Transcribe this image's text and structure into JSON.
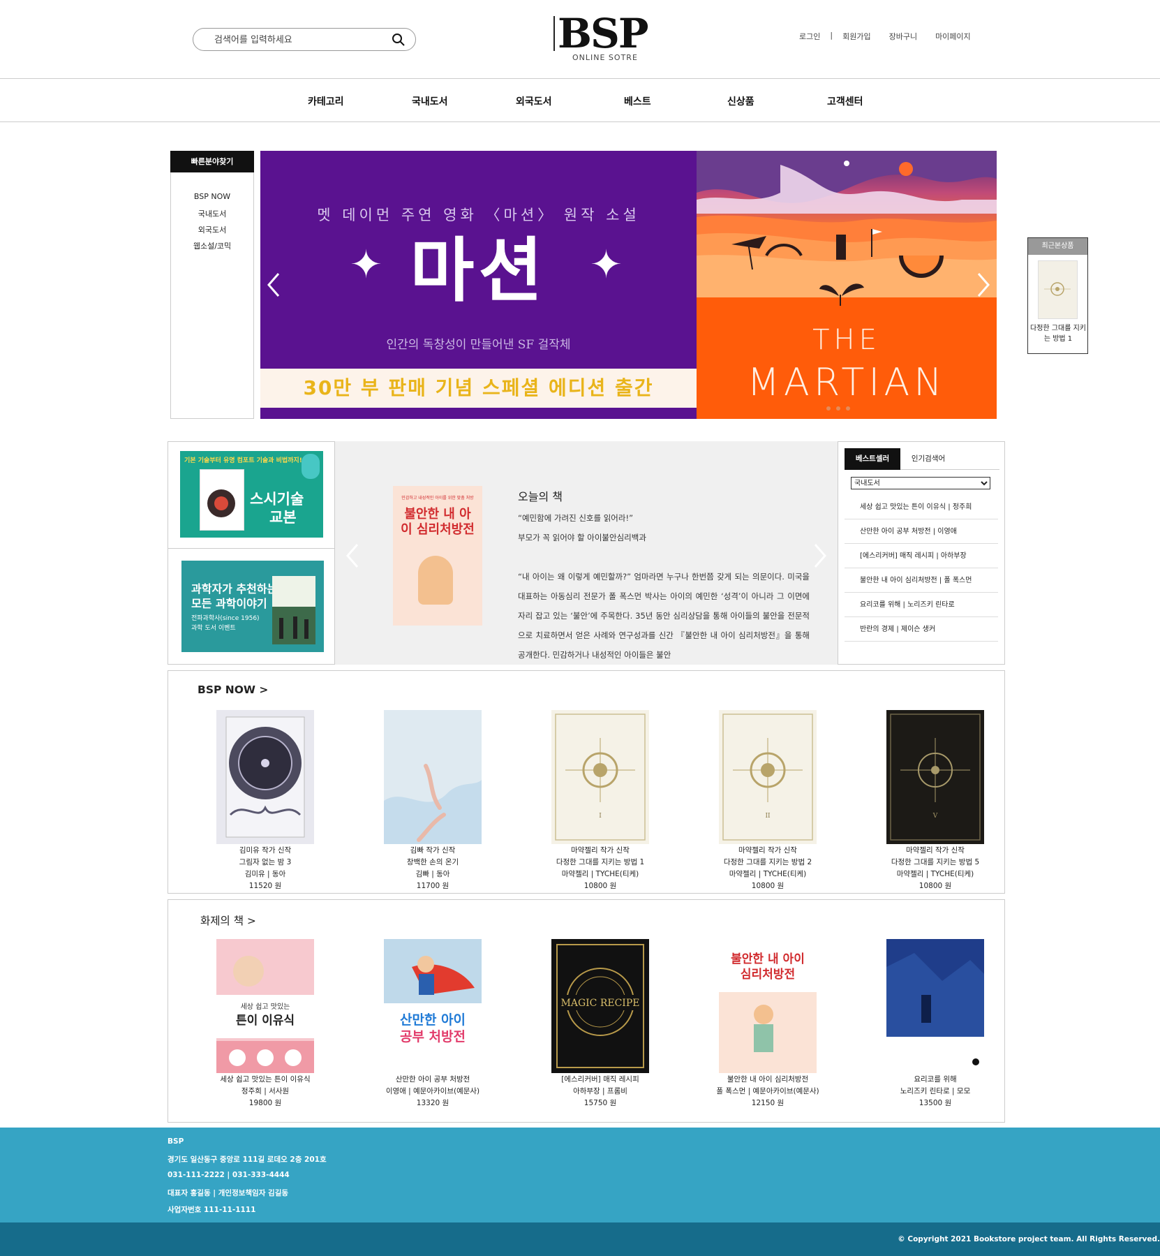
{
  "header": {
    "search_placeholder": "검색어를 입력하세요",
    "logo_text": "BSP",
    "logo_sub": "ONLINE SOTRE",
    "util_links": [
      "로그인",
      "|",
      "회원가입",
      "장바구니",
      "마이페이지"
    ]
  },
  "nav": {
    "items": [
      "카테고리",
      "국내도서",
      "외국도서",
      "베스트",
      "신상품",
      "고객센터"
    ]
  },
  "quick_find": {
    "title": "빠른분야찾기",
    "items": [
      "BSP NOW",
      "국내도서",
      "외국도서",
      "웹소설/코믹"
    ]
  },
  "banner": {
    "kicker": "멧 데이먼 주연 영화 〈마션〉 원작 소설",
    "title": "마션",
    "tagline": "인간의 독창성이 만들어낸 SF 걸작체",
    "strip": "30만 부 판매 기념 스페셜 에디션 출간",
    "english_title_1": "THE",
    "english_title_2": "MARTIAN",
    "colors": {
      "purple": "#5a1290",
      "orange": "#ff5c0a",
      "gold": "#e9b41a"
    },
    "slide_dots": 3
  },
  "recent": {
    "title": "최근본상품",
    "caption": "다정한 그대를 지키는 방법 1"
  },
  "promos": {
    "p1": {
      "top": "기본 기술부터 유명 컴포트 기술과 비법까지!",
      "title_1": "스시기술",
      "title_2": "교본"
    },
    "p2": {
      "title_1": "과학자가 추천하는",
      "title_2": "모든 과학이야기",
      "sub_1": "전파과학사(since 1956)",
      "sub_2": "과학 도서 이벤트"
    }
  },
  "today": {
    "heading": "오늘의 책",
    "cover_title": "불안한 내 아이 심리처방전",
    "cover_kicker": "민감하고 내성적인 아이를 위한 맞춤 처방",
    "quote": "“예민함에 가려진 신호를 읽어라!”",
    "subtitle": "부모가 꼭 읽어야 할 아이불안심리백과",
    "body": "“내 아이는 왜 이렇게 예민할까?” 엄마라면 누구나 한번쯤 갖게 되는 의문이다. 미국을 대표하는 아동심리 전문가 폴 폭스먼 박사는 아이의 예민한 ‘성격’이 아니라 그 이면에 자리 잡고 있는 ‘불안’에 주목한다. 35년 동안 심리상담을 통해 아이들의 불안을 전문적으로 치료하면서 얻은 사례와 연구성과를 신간 『불안한 내 아이 심리처방전』을 통해 공개한다. 민감하거나 내성적인 아이들은 불안"
  },
  "bestseller": {
    "tab_active": "베스트셀러",
    "tab_other": "인기검색어",
    "select_value": "국내도서",
    "items": [
      "세상 쉽고 맛있는 튼이 이유식 | 정주희",
      "산만한 아이 공부 처방전 | 이영애",
      "[에스리커버] 매직 레시피 | 아하부장",
      "불안한 내 아이 심리처방전 | 폴 폭스먼",
      "요리코를 위해 | 노리즈키 린타로",
      "반란의 경제 | 제이슨 생커"
    ]
  },
  "bsp_now": {
    "title": "BSP NOW >",
    "books": [
      {
        "tag": "김미유 작가 신작",
        "title": "그림자 없는 밤 3",
        "meta": "김미유 | 동아",
        "price": "11520 원",
        "cover": "shadow"
      },
      {
        "tag": "김빠 작가 신작",
        "title": "창백한 손의 온기",
        "meta": "김빠 | 동아",
        "price": "11700 원",
        "cover": "pale"
      },
      {
        "tag": "마약젤리 작가 신작",
        "title": "다정한 그대를 지키는 방법 1",
        "meta": "마약젤리 | TYCHE(티케)",
        "price": "10800 원",
        "cover": "cream",
        "roman": "I"
      },
      {
        "tag": "마약젤리 작가 신작",
        "title": "다정한 그대를 지키는 방법 2",
        "meta": "마약젤리 | TYCHE(티케)",
        "price": "10800 원",
        "cover": "cream",
        "roman": "II"
      },
      {
        "tag": "마약젤리 작가 신작",
        "title": "다정한 그대를 지키는 방법 5",
        "meta": "마약젤리 | TYCHE(티케)",
        "price": "10800 원",
        "cover": "dark",
        "roman": "V"
      }
    ]
  },
  "hot_books": {
    "title": "화제의 책 >",
    "books": [
      {
        "title": "세상 쉽고 맛있는 튼이 이유식",
        "meta": "정주희 | 서사원",
        "price": "19800 원",
        "cover": "baby"
      },
      {
        "title": "산만한 아이 공부 처방전",
        "meta": "이영애 | 예문아카이브(예문사)",
        "price": "13320 원",
        "cover": "hero"
      },
      {
        "title": "[에스리커버] 매직 레시피",
        "meta": "아하부장 | 프롬비",
        "price": "15750 원",
        "cover": "magic"
      },
      {
        "title": "불안한 내 아이 심리처방전",
        "meta": "폴 폭스먼 | 예문아카이브(예문사)",
        "price": "12150 원",
        "cover": "anxious"
      },
      {
        "title": "요리코를 위해",
        "meta": "노리즈키 린타로 | 모모",
        "price": "13500 원",
        "cover": "blue"
      }
    ]
  },
  "cover_text": {
    "baby_title": "세상 쉽고 맛있는",
    "baby_title_2": "튼이 이유식",
    "hero_title": "산만한 아이",
    "hero_title_2": "공부 처방전",
    "magic_title": "MAGIC RECIPE",
    "anxious_title": "불안한 내 아이",
    "anxious_title_2": "심리처방전"
  },
  "footer": {
    "lines": [
      "BSP",
      "경기도 일산동구 중앙로 111길 로데오 2층 201호",
      "031-111-2222 | 031-333-4444",
      "대표자 홍길동 | 개인정보책임자 김길동",
      "사업자번호 111-11-1111"
    ],
    "copyright": "© Copyright 2021 Bookstore project team. All Rights Reserved."
  }
}
